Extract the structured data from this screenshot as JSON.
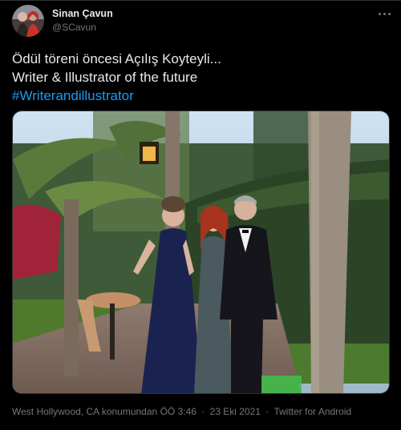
{
  "author": {
    "name": "Sinan Çavun",
    "handle": "@SCavun"
  },
  "tweet": {
    "line1": "Ödül töreni öncesi Açılış Koyteyli...",
    "line2": "Writer & Illustrator of the future",
    "hashtag": "#Writerandillustrator"
  },
  "meta": {
    "location": "West Hollywood, CA konumundan",
    "time": "ÖÖ 3:46",
    "date": "23 Eki 2021",
    "source": "Twitter for Android",
    "separator": "·"
  },
  "icons": {
    "more": "more-icon"
  },
  "colors": {
    "background": "#000000",
    "text": "#e7e9ea",
    "muted": "#71767b",
    "link": "#1d9bf0"
  }
}
